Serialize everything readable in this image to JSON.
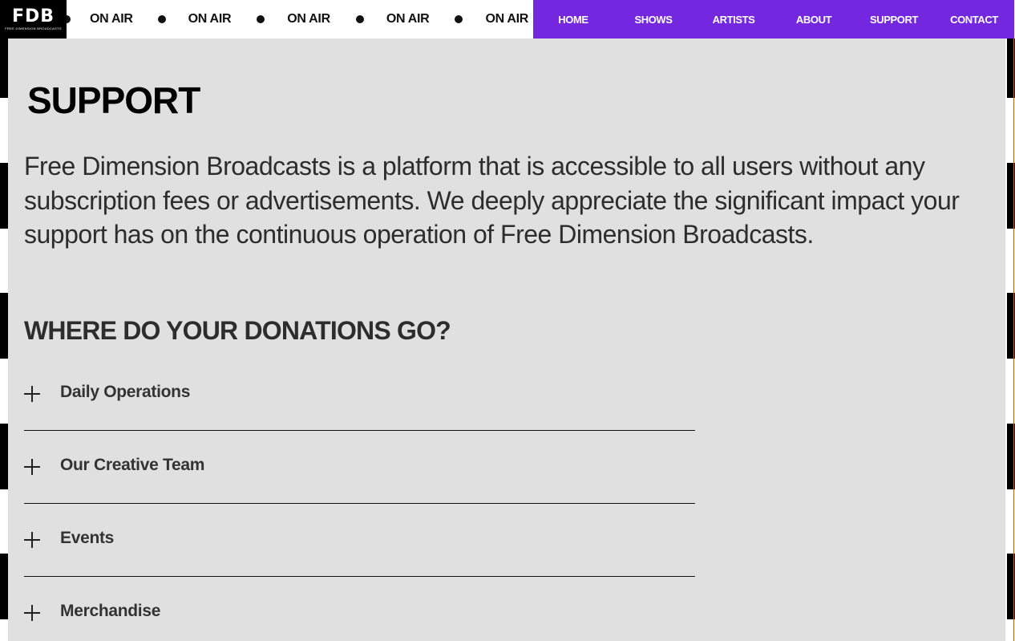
{
  "logo": {
    "mark": "FDB",
    "subtitle": "FREE DIMENSION BROADCASTS"
  },
  "ticker": {
    "items": [
      "ON AIR",
      "ON AIR",
      "ON AIR",
      "ON AIR",
      "ON AIR"
    ]
  },
  "nav": {
    "items": [
      "HOME",
      "SHOWS",
      "ARTISTS",
      "ABOUT",
      "SUPPORT",
      "CONTACT"
    ]
  },
  "colors": {
    "nav_bg": "#7328e0",
    "panel_bg": "#e0e0e0"
  },
  "main": {
    "title": "SUPPORT",
    "intro": "Free Dimension Broadcasts is a platform that is accessible to all users without any subscription fees or advertisements. We deeply appreciate the significant impact your support has on the continuous operation of Free Dimension Broadcasts.",
    "section_title": "WHERE DO YOUR DONATIONS GO?",
    "accordion": [
      "Daily Operations",
      "Our Creative Team",
      "Events",
      "Merchandise"
    ]
  }
}
